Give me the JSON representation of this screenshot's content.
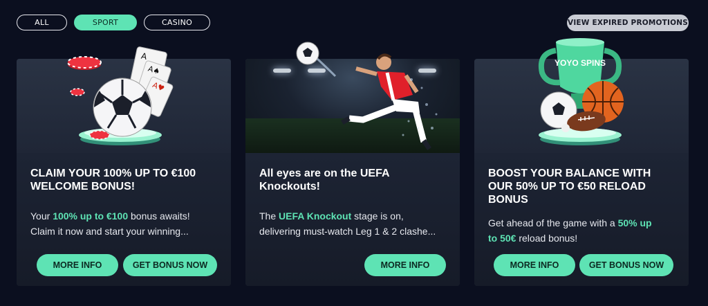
{
  "filters": {
    "all": "ALL",
    "sport": "SPORT",
    "casino": "CASINO",
    "active": "SPORT"
  },
  "expired_label": "VIEW EXPIRED PROMOTIONS",
  "colors": {
    "accent": "#5ee3b4",
    "background": "#0b0f1f",
    "card": "#1c2333"
  },
  "cards": [
    {
      "title_1": "CLAIM YOUR 100% UP TO €100",
      "title_2": "WELCOME BONUS!",
      "desc_1_pre": "Your ",
      "desc_1_hl": "100% up to €100",
      "desc_1_post": " bonus awaits!",
      "desc_2": "Claim it now and start your winning...",
      "more_info": "MORE INFO",
      "get_bonus": "GET BONUS NOW",
      "art": "soccer-ball-casino-chips-cards"
    },
    {
      "title_1": "All eyes are on the UEFA",
      "title_2": "Knockouts!",
      "desc_1_pre": "The ",
      "desc_1_hl": "UEFA Knockout",
      "desc_1_post": " stage is on,",
      "desc_2": "delivering must-watch Leg 1 & 2 clashe...",
      "more_info": "MORE INFO",
      "art": "football-player-kicking-ball"
    },
    {
      "title_1": "BOOST YOUR BALANCE WITH",
      "title_2": "OUR 50% UP TO €50 RELOAD",
      "title_3": "BONUS",
      "desc_1_pre": "Get ahead of the game with a ",
      "desc_1_hl": "50% up",
      "desc_2_hl": "to 50€",
      "desc_2_post": " reload bonus!",
      "more_info": "MORE INFO",
      "get_bonus": "GET BONUS NOW",
      "art": "trophy-with-sports-balls",
      "logo_text": "YOYO SPINS"
    }
  ]
}
